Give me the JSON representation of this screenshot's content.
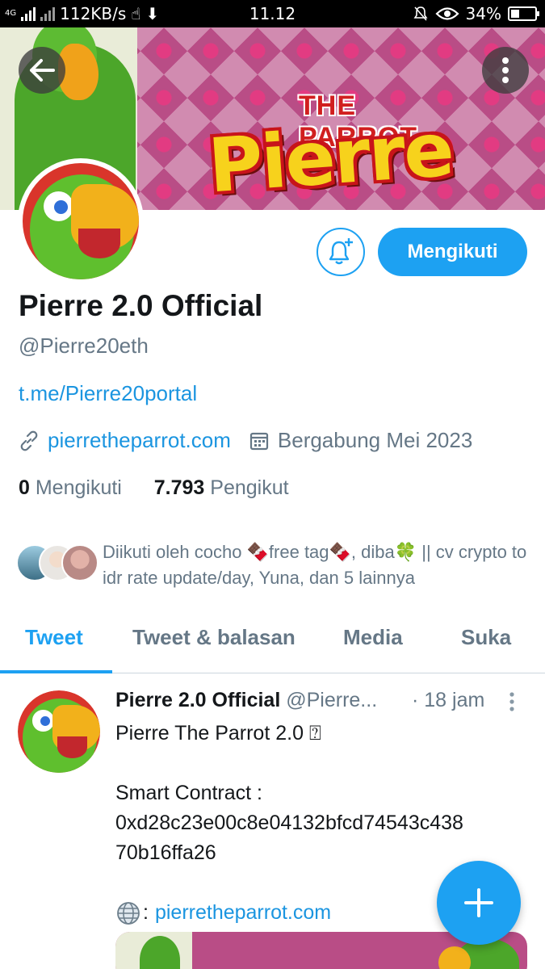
{
  "status_bar": {
    "network": "4G",
    "speed": "112KB/s",
    "time": "11.12",
    "battery": "34%"
  },
  "profile": {
    "banner_logo_small": "THE PARROT",
    "banner_logo_big": "Pierre",
    "follow_button_label": "Mengikuti",
    "name": "Pierre 2.0 Official",
    "handle": "@Pierre20eth",
    "bio_link": "t.me/Pierre20portal",
    "website": "pierretheparrot.com",
    "joined": "Bergabung Mei 2023",
    "following_count": "0",
    "following_label": "Mengikuti",
    "followers_count": "7.793",
    "followers_label": "Pengikut",
    "followed_by": "Diikuti oleh cocho 🍫free tag🍫, diba🍀 || cv crypto to idr rate update/day, Yuna, dan 5 lainnya"
  },
  "tabs": [
    {
      "label": "Tweet",
      "active": true
    },
    {
      "label": "Tweet & balasan",
      "active": false
    },
    {
      "label": "Media",
      "active": false
    },
    {
      "label": "Suka",
      "active": false
    }
  ],
  "tweet": {
    "author_name": "Pierre 2.0 Official",
    "author_handle": "@Pierre...",
    "time": "· 18 jam",
    "line1": "Pierre The Parrot 2.0 ⍰",
    "line2": "Smart Contract :",
    "line3": "0xd28c23e00c8e04132bfcd74543c438",
    "line4": "70b16ffa26",
    "link_prefix": ":",
    "link": "pierretheparrot.com"
  },
  "colors": {
    "accent": "#1da1f2",
    "link": "#1b95e0",
    "muted": "#657786"
  },
  "icons": [
    "back-arrow-icon",
    "more-vertical-icon",
    "notification-bell-plus-icon",
    "link-icon",
    "calendar-icon",
    "caret-vertical-icon",
    "globe-icon",
    "compose-plus-icon"
  ]
}
